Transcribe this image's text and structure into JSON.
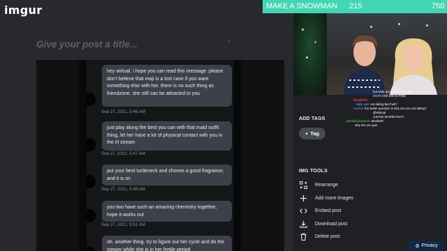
{
  "app": {
    "logo": "imgur"
  },
  "title": {
    "placeholder": "Give your post a title..."
  },
  "messages": [
    {
      "text": "hey wirtual, i hope you can read this message. please don't believe that maji is a lost case if you want something else with her. there is no such thing as friendzone. she still can be attracted to you",
      "time": "Sep 27, 2021, 5:46 AM"
    },
    {
      "text": "just play along the best you can with that maid outfit thing, let her have a lot of physical contact with you in the irl stream",
      "time": "Sep 27, 2021, 5:47 AM"
    },
    {
      "text": "put your best turtleneck and choose a good fragrance, and it is on",
      "time": "Sep 27, 2021, 5:48 AM"
    },
    {
      "text": "you two have such an amazing chemistry together, hope it works out",
      "time": "Sep 27, 2021, 5:51 AM"
    },
    {
      "text": "oh. another thing. try to figure out her cycle and do the stream while she is in her fertile period",
      "time": ""
    }
  ],
  "tags": {
    "title": "ADD TAGS",
    "button_label": "Tag"
  },
  "tools": {
    "title": "IMG TOOLS",
    "items": [
      {
        "label": "Rearrange",
        "icon": "rearrange-icon"
      },
      {
        "label": "Add more images",
        "icon": "plus-icon"
      },
      {
        "label": "Embed post",
        "icon": "code-icon"
      },
      {
        "label": "Download post",
        "icon": "download-icon"
      },
      {
        "label": "Delete post",
        "icon": "trash-icon"
      }
    ]
  },
  "stream": {
    "game_label": "MAKE A SNOWMAN",
    "score_left": "215",
    "score_right": "750",
    "bar_color": "#43d6b5",
    "chat": [
      {
        "user": "",
        "text": "but what are you leaving you?",
        "color": "#ffffff"
      },
      {
        "user": "",
        "text": "CHAT ARE WE DATING",
        "color": "#ffffff"
      },
      {
        "user": "WesiHTM",
        "text": "",
        "color": "#e84b4b"
      },
      {
        "user": "nick_azz",
        "text": "not dating but Fwb?",
        "color": "#5aa0ff"
      },
      {
        "user": "naufea",
        "text": "the better question is why are you not dating?",
        "color": "#7a6bff"
      },
      {
        "user": "",
        "text": "@Wirtual",
        "color": "#ffffff"
      },
      {
        "user": "",
        "text": "Just the benefits then?",
        "color": "#ffffff"
      },
      {
        "user": "pearlbaaiopecat",
        "text": "MonkaW",
        "color": "#4caf50"
      },
      {
        "user": "",
        "text": "why are you gae",
        "color": "#ffffff"
      }
    ]
  },
  "privacy": {
    "label": "Privacy"
  }
}
